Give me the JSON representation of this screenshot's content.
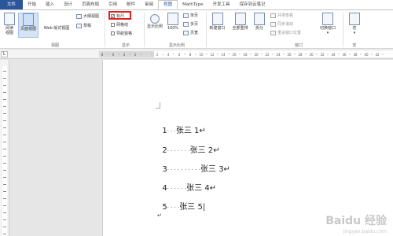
{
  "tabs": [
    "文件",
    "开始",
    "插入",
    "设计",
    "页面布局",
    "引用",
    "邮件",
    "审阅",
    "视图",
    "MathType",
    "开发工具",
    "保存到云笔记"
  ],
  "active_tab_index": 8,
  "ribbon": {
    "views": {
      "read_mode": "阅读\n视图",
      "print_layout": "页面视图",
      "web_layout": "Web 版式视图",
      "outline": "大纲视图",
      "draft": "草稿",
      "group_label": "视图"
    },
    "show": {
      "ruler": "标尺",
      "ruler_checked": "✓",
      "gridlines": "网格线",
      "nav_pane": "导航窗格",
      "group_label": "显示"
    },
    "zoom": {
      "zoom": "显示比例",
      "hundred": "100%",
      "one_page": "单页",
      "multi_page": "多页",
      "page_width": "页宽",
      "group_label": "显示比例"
    },
    "window": {
      "new_window": "新建窗口",
      "arrange_all": "全部重排",
      "split": "拆分",
      "side_by_side": "并排查看",
      "sync_scroll": "同步滚动",
      "reset_pos": "重设窗口位置",
      "switch_windows": "切换窗口",
      "group_label": "窗口"
    },
    "macros": {
      "macros": "宏",
      "group_label": "宏"
    }
  },
  "ruler": {
    "corner": "L",
    "ticks": [
      "8",
      "6",
      "4",
      "2",
      "",
      "2",
      "4",
      "6",
      "8",
      "10",
      "12",
      "14",
      "16",
      "18",
      "20",
      "22",
      "24",
      "26",
      "28",
      "30",
      "32",
      "34",
      "36",
      "38",
      "40",
      "42"
    ]
  },
  "document": {
    "lines": [
      {
        "num": "1",
        "dots": "· · ·",
        "text": "张三",
        "tail": " 1↵"
      },
      {
        "num": "2",
        "dots": "· · · · · · ·",
        "text": "张三",
        "tail": " 2↵"
      },
      {
        "num": "3",
        "dots": "· · · · · · · · · ·",
        "text": "张三",
        "tail": " 3↵"
      },
      {
        "num": "4",
        "dots": "· · · · · ·",
        "text": "张三",
        "tail": " 4↵"
      },
      {
        "num": "5",
        "dots": "· · · ·",
        "text": "张三",
        "tail": " 5|"
      }
    ],
    "trailing_mark": "↵"
  },
  "watermark": {
    "brand": "Baidu 经验",
    "url": "jingyan.baidu.com"
  }
}
